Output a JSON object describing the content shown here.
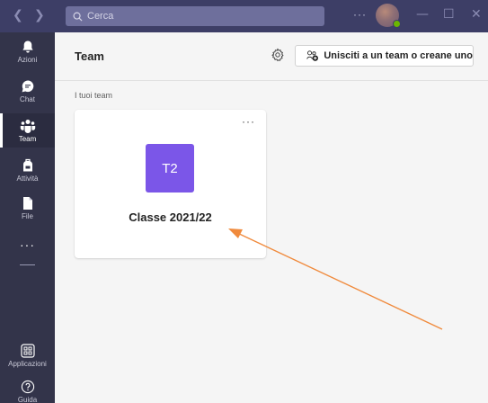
{
  "titlebar": {
    "back_icon": "chevron-left-icon",
    "forward_icon": "chevron-right-icon",
    "search_placeholder": "Cerca",
    "more_label": "···",
    "minimize_label": "—",
    "maximize_label": "☐",
    "close_label": "✕"
  },
  "rail": {
    "items": [
      {
        "label": "Azioni",
        "icon": "bell-icon"
      },
      {
        "label": "Chat",
        "icon": "chat-icon"
      },
      {
        "label": "Team",
        "icon": "teams-icon"
      },
      {
        "label": "Attività",
        "icon": "backpack-icon"
      },
      {
        "label": "File",
        "icon": "file-icon"
      }
    ],
    "more_label": "···",
    "apps_label": "Applicazioni",
    "help_label": "Guida"
  },
  "header": {
    "title": "Team",
    "join_button_label": "Unisciti a un team o creane uno"
  },
  "content": {
    "section_label": "I tuoi team",
    "teams": [
      {
        "initials": "T2",
        "name": "Classe 2021/22",
        "more_label": "···"
      }
    ]
  },
  "colors": {
    "titlebar": "#3d3e66",
    "rail": "#33344a",
    "team_avatar": "#7b56e8",
    "annotation_arrow": "#f08a3c",
    "presence": "#6bb700"
  }
}
